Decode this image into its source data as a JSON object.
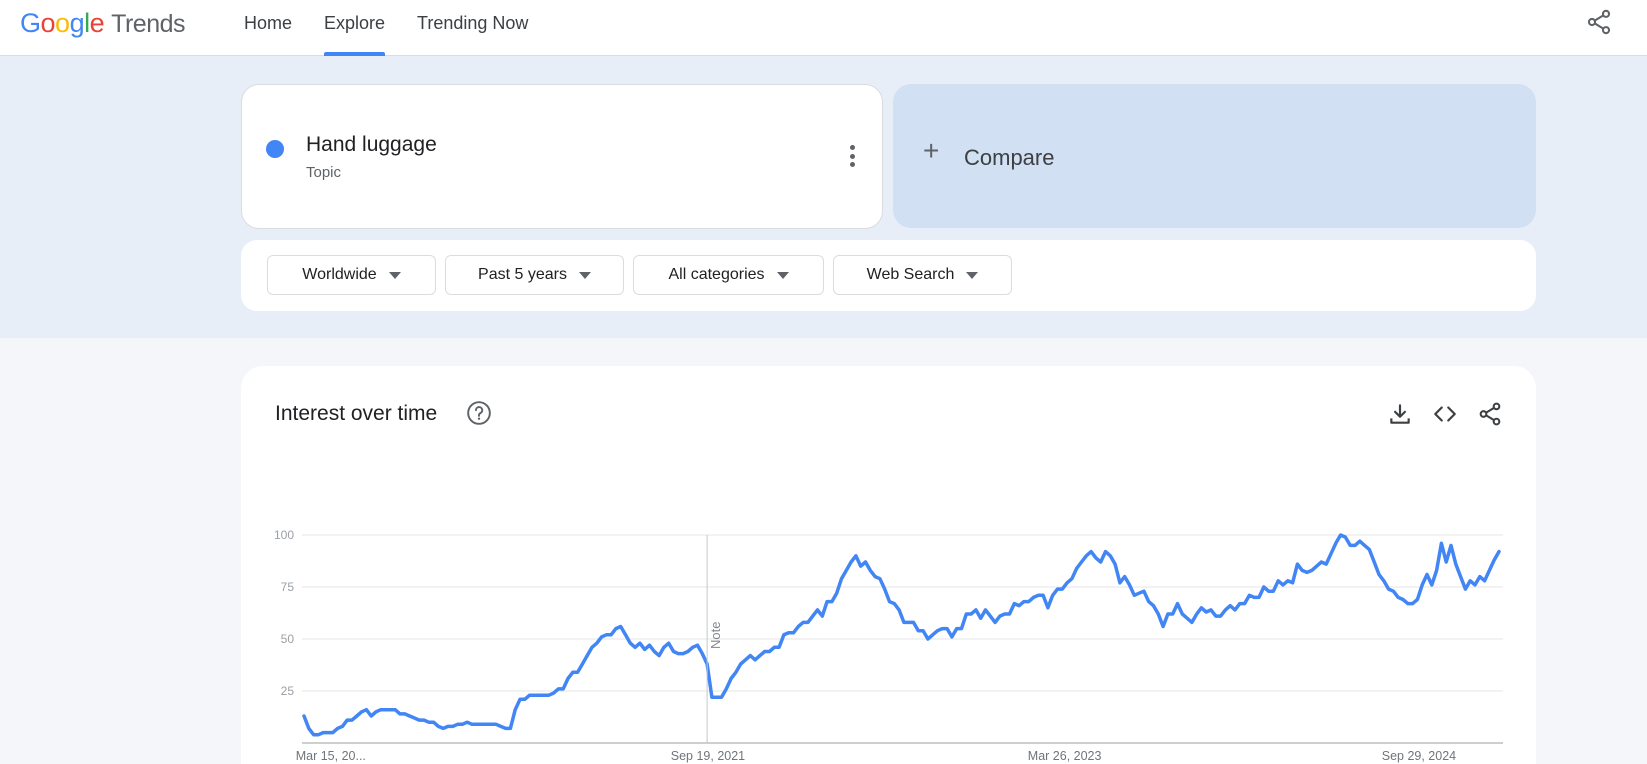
{
  "header": {
    "logo_google": [
      "G",
      "o",
      "o",
      "g",
      "l",
      "e"
    ],
    "logo_trends": "Trends",
    "nav": [
      {
        "label": "Home",
        "active": false
      },
      {
        "label": "Explore",
        "active": true
      },
      {
        "label": "Trending Now",
        "active": false
      }
    ],
    "share_icon": "share-icon"
  },
  "search_term": {
    "name": "Hand luggage",
    "type": "Topic",
    "color": "#4285f4",
    "menu_icon": "more-vert-icon"
  },
  "compare": {
    "label": "Compare",
    "icon": "plus-icon"
  },
  "filters": {
    "region": "Worldwide",
    "time": "Past 5 years",
    "category": "All categories",
    "search_type": "Web Search"
  },
  "interest_over_time": {
    "title": "Interest over time",
    "help_icon": "help-circle-icon",
    "tools": [
      "download-icon",
      "embed-code-icon",
      "share-icon"
    ],
    "note": "Note"
  },
  "chart_data": {
    "type": "line",
    "title": "",
    "xlabel": "",
    "ylabel": "",
    "ylim": [
      0,
      100
    ],
    "yticks": [
      25,
      50,
      75,
      100
    ],
    "x_tick_labels": [
      "Mar 15, 20...",
      "Sep 19, 2021",
      "Mar 26, 2023",
      "Sep 29, 2024"
    ],
    "grid": true,
    "series": [
      {
        "color": "#4285f4",
        "values": [
          13,
          7,
          4,
          4,
          5,
          5,
          5,
          7,
          8,
          11,
          11,
          13,
          15,
          16,
          13,
          15,
          16,
          16,
          16,
          16,
          14,
          14,
          13,
          12,
          11,
          11,
          10,
          10,
          8,
          7,
          8,
          8,
          9,
          9,
          10,
          9,
          9,
          9,
          9,
          9,
          9,
          8,
          7,
          7,
          16,
          21,
          21,
          23,
          23,
          23,
          23,
          23,
          24,
          26,
          26,
          31,
          34,
          34,
          38,
          42,
          46,
          48,
          51,
          52,
          52,
          55,
          56,
          52,
          48,
          46,
          48,
          45,
          47,
          44,
          42,
          46,
          48,
          44,
          43,
          43,
          44,
          46,
          47,
          43,
          38,
          22,
          22,
          22,
          26,
          31,
          34,
          38,
          40,
          42,
          40,
          42,
          44,
          44,
          46,
          46,
          52,
          53,
          53,
          56,
          58,
          58,
          61,
          64,
          61,
          68,
          68,
          72,
          79,
          83,
          87,
          90,
          85,
          87,
          83,
          80,
          79,
          74,
          68,
          67,
          64,
          58,
          58,
          58,
          54,
          54,
          50,
          52,
          54,
          55,
          55,
          51,
          55,
          55,
          62,
          62,
          64,
          60,
          64,
          61,
          58,
          61,
          62,
          62,
          67,
          66,
          68,
          68,
          70,
          71,
          71,
          65,
          71,
          74,
          74,
          77,
          79,
          84,
          87,
          90,
          92,
          89,
          87,
          92,
          90,
          86,
          77,
          80,
          76,
          71,
          72,
          73,
          68,
          66,
          62,
          56,
          62,
          62,
          67,
          62,
          60,
          58,
          62,
          65,
          63,
          64,
          61,
          61,
          64,
          66,
          64,
          67,
          67,
          71,
          70,
          70,
          75,
          73,
          73,
          78,
          76,
          78,
          77,
          86,
          83,
          82,
          83,
          85,
          87,
          86,
          91,
          96,
          100,
          99,
          95,
          95,
          97,
          95,
          93,
          87,
          81,
          78,
          74,
          73,
          70,
          69,
          67,
          67,
          69,
          76,
          81,
          76,
          83,
          96,
          87,
          95,
          86,
          80,
          74,
          78,
          76,
          80,
          78,
          83,
          88,
          92
        ]
      }
    ]
  }
}
